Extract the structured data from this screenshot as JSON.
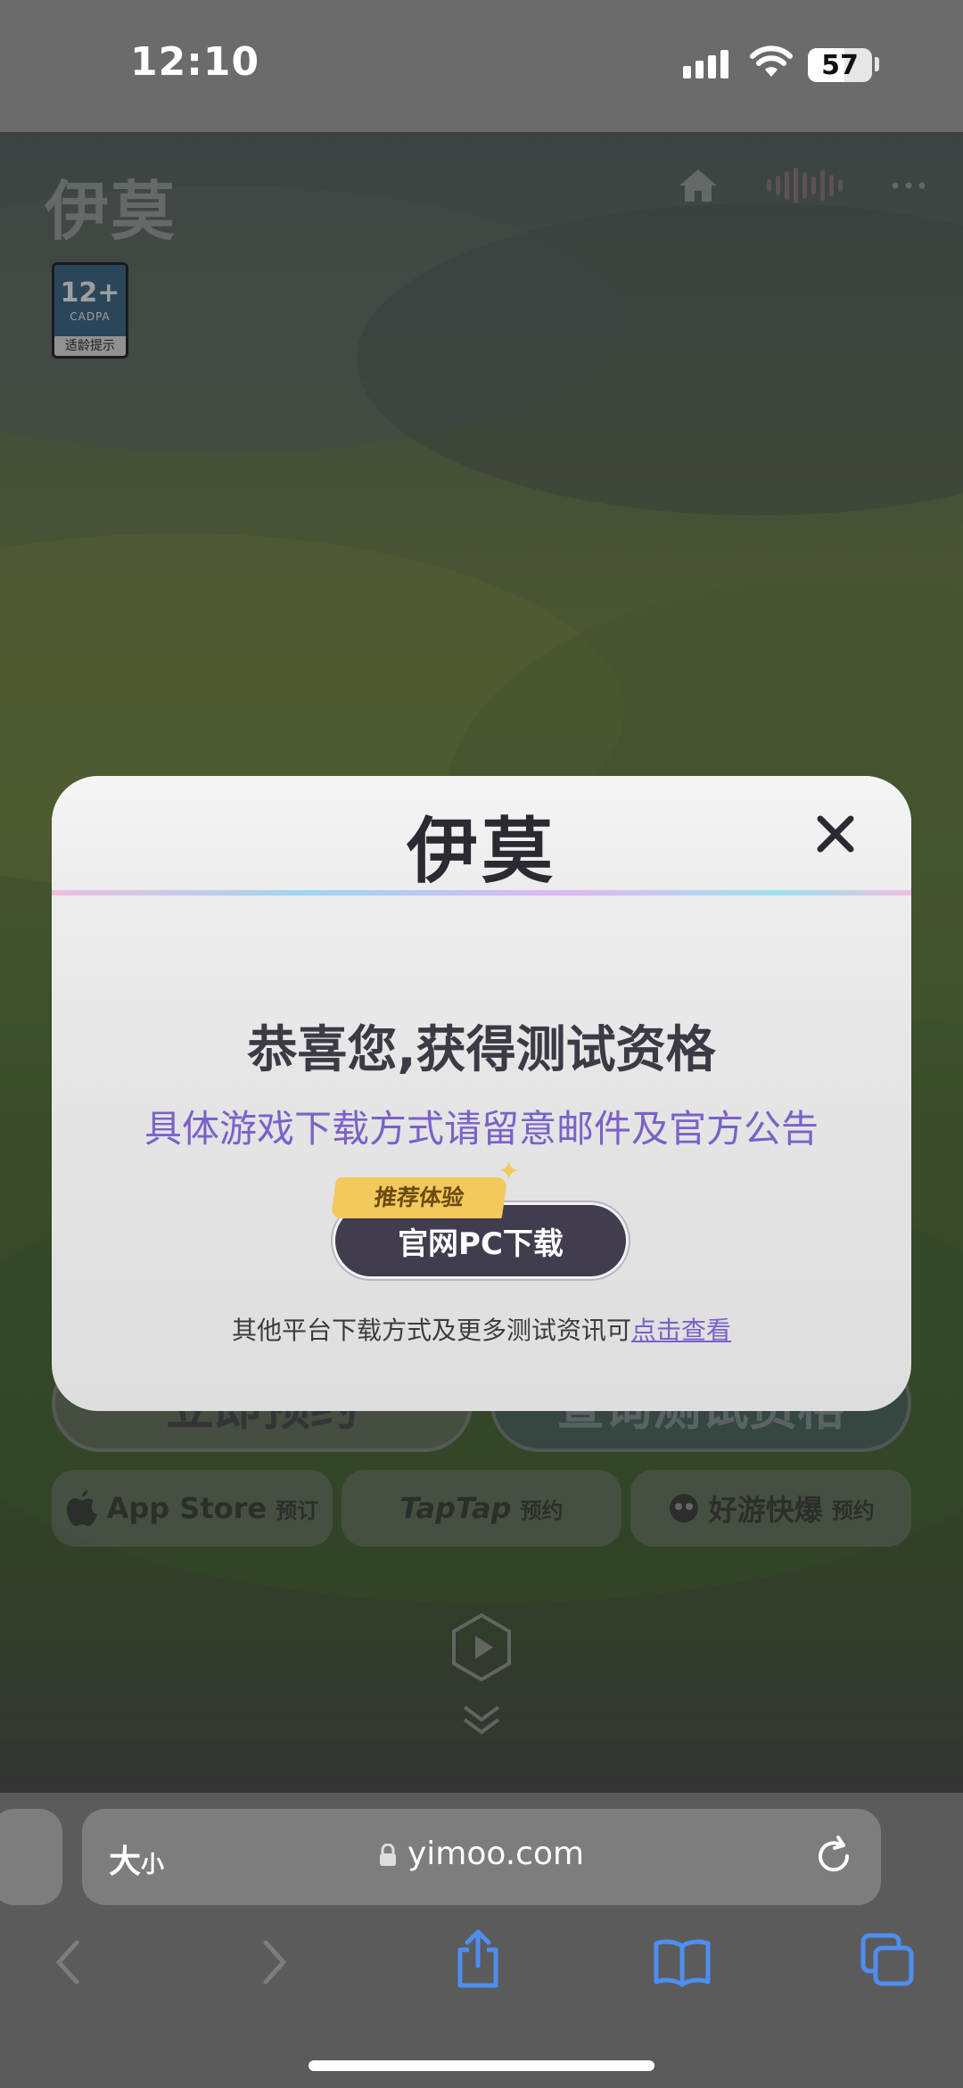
{
  "status_bar": {
    "time": "12:10",
    "battery_level": "57"
  },
  "site": {
    "logo_text": "伊莫",
    "age_rating": {
      "age": "12+",
      "org": "CADPA",
      "hint": "适龄提示"
    },
    "nav_icons": [
      "home-icon",
      "music-icon",
      "more-icon"
    ],
    "reserve_button": "立即预约",
    "query_button": "查询测试资格",
    "stores": [
      {
        "name": "App Store",
        "action": "预订",
        "icon": "apple-icon"
      },
      {
        "name": "TapTap",
        "action": "预约",
        "icon": ""
      },
      {
        "name": "好游快爆",
        "action": "预约",
        "icon": "haoyou-icon"
      }
    ]
  },
  "modal": {
    "logo_text": "伊莫",
    "title": "恭喜您,获得测试资格",
    "subtitle": "具体游戏下载方式请留意邮件及官方公告",
    "recommend_tag": "推荐体验",
    "download_button": "官网PC下载",
    "footer_text": "其他平台下载方式及更多测试资讯可",
    "footer_link": "点击查看"
  },
  "browser": {
    "text_size_big": "大",
    "text_size_small": "小",
    "url": "yimoo.com"
  },
  "colors": {
    "accent_purple": "#7a62c8",
    "tag_gold": "#f2c95a",
    "button_dark": "#413d4f"
  }
}
